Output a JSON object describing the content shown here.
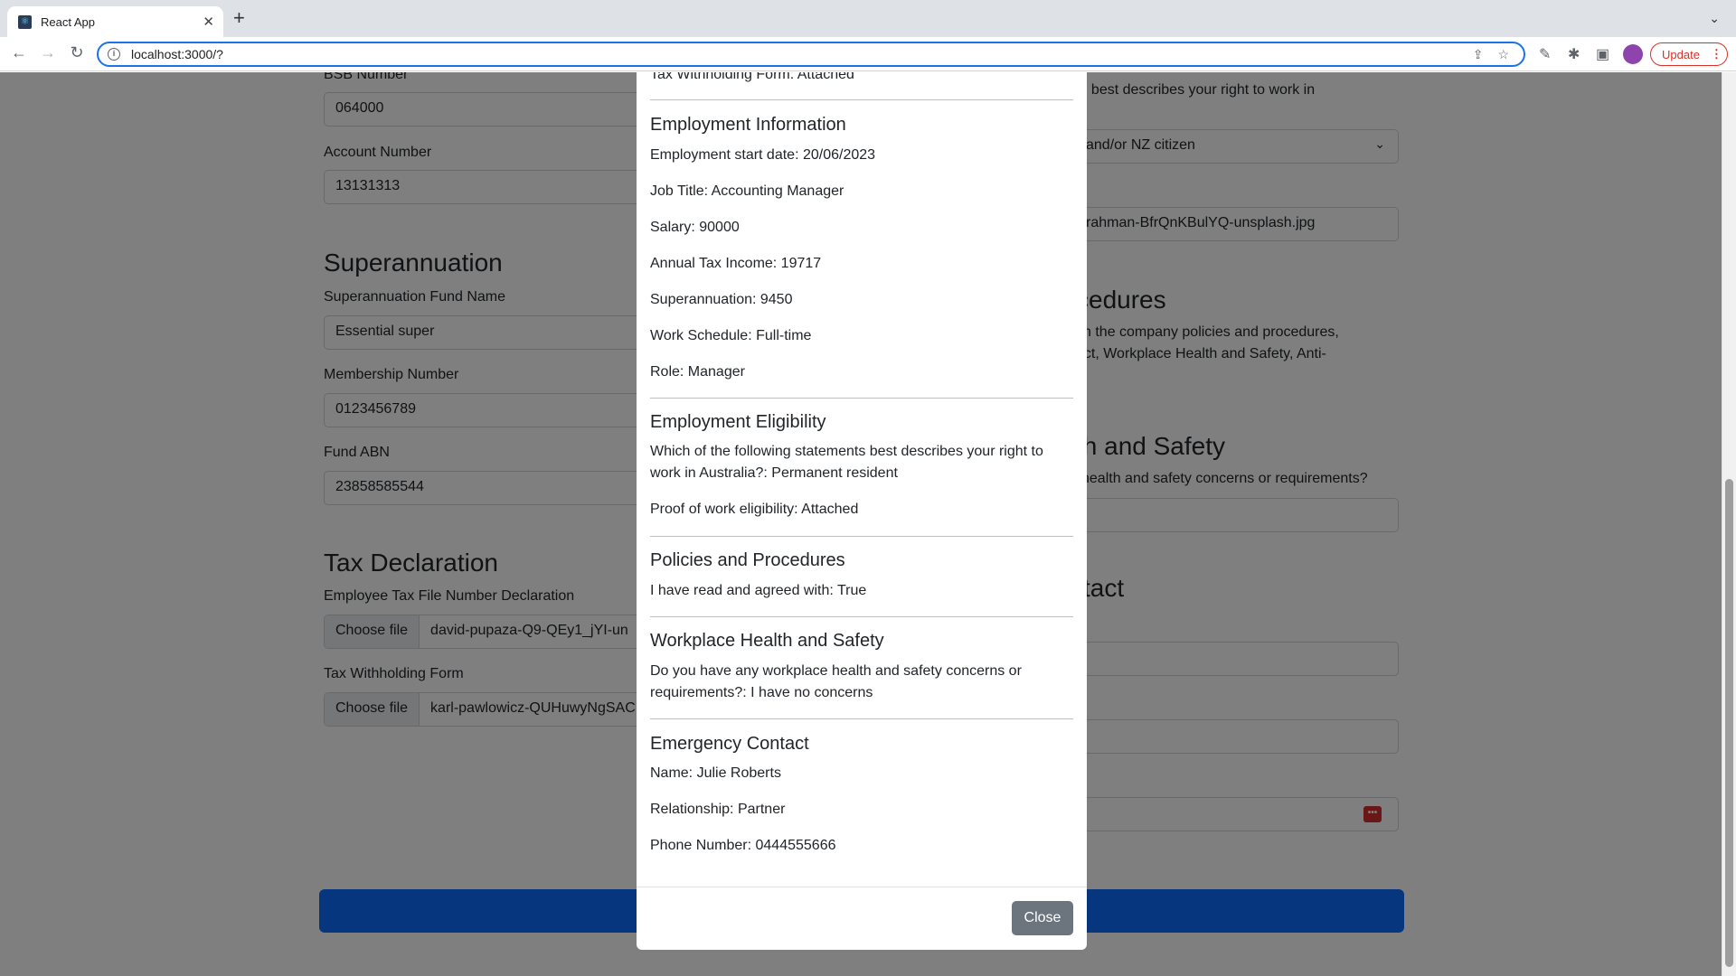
{
  "browser": {
    "tab_title": "React App",
    "url": "localhost:3000/?",
    "update_label": "Update"
  },
  "left": {
    "bsb_label": "BSB Number",
    "bsb_value": "064000",
    "account_label": "Account Number",
    "account_value": "13131313",
    "super_heading": "Superannuation",
    "fund_label": "Superannuation Fund Name",
    "fund_value": "Essential super",
    "membership_label": "Membership Number",
    "membership_value": "0123456789",
    "abn_label": "Fund ABN",
    "abn_value": "23858585544",
    "tax_heading": "Tax Declaration",
    "tfn_label": "Employee Tax File Number Declaration",
    "choose_file": "Choose file",
    "tfn_file": "david-pupaza-Q9-QEy1_jYI-un",
    "withholding_label": "Tax Withholding Form",
    "withholding_file": "karl-pawlowicz-QUHuwyNgSAC"
  },
  "right": {
    "eligibility_text": "ements best describes your right to work in",
    "citizen_value": "and/or NZ citizen",
    "proof_file": "rahman-BfrQnKBulYQ-unsplash.jpg",
    "policies_heading": "cedures",
    "policies_text_1": "ith the company policies and procedures,",
    "policies_text_2": "uct, Workplace Health and Safety, Anti-",
    "health_heading": "th and Safety",
    "health_text": "health and safety concerns or requirements?",
    "contact_heading": "tact"
  },
  "modal": {
    "top_line": "Tax Withholding Form: Attached",
    "employment_heading": "Employment Information",
    "start_date": "Employment start date: 20/06/2023",
    "job_title": "Job Title: Accounting Manager",
    "salary": "Salary: 90000",
    "annual_tax": "Annual Tax Income: 19717",
    "superannuation": "Superannuation: 9450",
    "work_schedule": "Work Schedule: Full-time",
    "role": "Role: Manager",
    "eligibility_heading": "Employment Eligibility",
    "eligibility_q": "Which of the following statements best describes your right to work in Australia?: Permanent resident",
    "proof": "Proof of work eligibility: Attached",
    "policies_heading": "Policies and Procedures",
    "policies_line": "I have read and agreed with: True",
    "whs_heading": "Workplace Health and Safety",
    "whs_line": "Do you have any workplace health and safety concerns or requirements?: I have no concerns",
    "emergency_heading": "Emergency Contact",
    "contact_name": "Name: Julie Roberts",
    "relationship": "Relationship: Partner",
    "phone": "Phone Number: 0444555666",
    "close_label": "Close"
  }
}
